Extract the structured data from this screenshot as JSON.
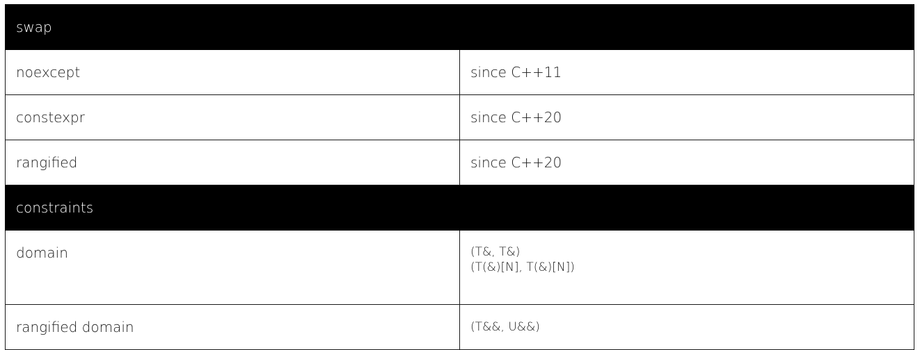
{
  "sections": [
    {
      "title": "swap",
      "rows": [
        {
          "key": "noexcept",
          "value": "since C++11"
        },
        {
          "key": "constexpr",
          "value": "since C++20"
        },
        {
          "key": "rangified",
          "value": "since C++20"
        }
      ]
    },
    {
      "title": "constraints",
      "rows": [
        {
          "key": "domain",
          "values": [
            "(T&, T&)",
            "(T(&)[N], T(&)[N])"
          ]
        },
        {
          "key": "rangified domain",
          "value": "(T&&, U&&)"
        }
      ]
    }
  ]
}
